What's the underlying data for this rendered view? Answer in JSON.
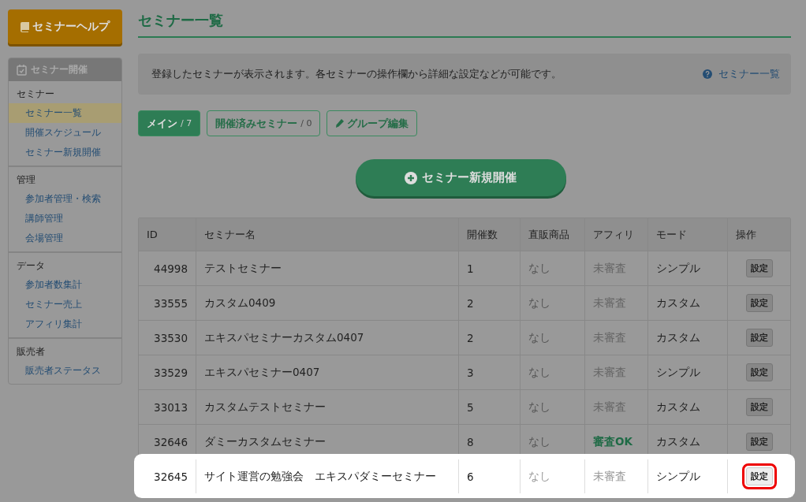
{
  "sidebar": {
    "help_button": "セミナーヘルプ",
    "panel_title": "セミナー開催",
    "sections": [
      {
        "heading": "セミナー",
        "items": [
          {
            "label": "セミナー一覧",
            "selected": true
          },
          {
            "label": "開催スケジュール",
            "selected": false
          },
          {
            "label": "セミナー新規開催",
            "selected": false
          }
        ]
      },
      {
        "heading": "管理",
        "items": [
          {
            "label": "参加者管理・検索",
            "selected": false
          },
          {
            "label": "講師管理",
            "selected": false
          },
          {
            "label": "会場管理",
            "selected": false
          }
        ]
      },
      {
        "heading": "データ",
        "items": [
          {
            "label": "参加者数集計",
            "selected": false
          },
          {
            "label": "セミナー売上",
            "selected": false
          },
          {
            "label": "アフィリ集計",
            "selected": false
          }
        ]
      },
      {
        "heading": "販売者",
        "items": [
          {
            "label": "販売者ステータス",
            "selected": false
          }
        ]
      }
    ]
  },
  "page_title": "セミナー一覧",
  "info": {
    "text": "登録したセミナーが表示されます。各セミナーの操作欄から詳細な設定などが可能です。",
    "help_link": "セミナー一覧"
  },
  "tabs": [
    {
      "label": "メイン",
      "count": "/ 7",
      "selected": true
    },
    {
      "label": "開催済みセミナー",
      "count": "/ 0",
      "selected": false
    }
  ],
  "group_edit_button": "グループ編集",
  "new_button": "セミナー新規開催",
  "table": {
    "columns": [
      "ID",
      "セミナー名",
      "開催数",
      "直販商品",
      "アフィリ",
      "モード",
      "操作"
    ],
    "rows": [
      {
        "id": "44998",
        "name": "テストセミナー",
        "count": "1",
        "product": "なし",
        "affiliate": "未審査",
        "approved": false,
        "mode": "シンプル",
        "action": "設定",
        "highlighted": false
      },
      {
        "id": "33555",
        "name": "カスタム0409",
        "count": "2",
        "product": "なし",
        "affiliate": "未審査",
        "approved": false,
        "mode": "カスタム",
        "action": "設定",
        "highlighted": false
      },
      {
        "id": "33530",
        "name": "エキスパセミナーカスタム0407",
        "count": "2",
        "product": "なし",
        "affiliate": "未審査",
        "approved": false,
        "mode": "カスタム",
        "action": "設定",
        "highlighted": false
      },
      {
        "id": "33529",
        "name": "エキスパセミナー0407",
        "count": "3",
        "product": "なし",
        "affiliate": "未審査",
        "approved": false,
        "mode": "シンプル",
        "action": "設定",
        "highlighted": false
      },
      {
        "id": "33013",
        "name": "カスタムテストセミナー",
        "count": "5",
        "product": "なし",
        "affiliate": "未審査",
        "approved": false,
        "mode": "カスタム",
        "action": "設定",
        "highlighted": false
      },
      {
        "id": "32646",
        "name": "ダミーカスタムセミナー",
        "count": "8",
        "product": "なし",
        "affiliate": "審査OK",
        "approved": true,
        "mode": "カスタム",
        "action": "設定",
        "highlighted": false
      },
      {
        "id": "32645",
        "name": "サイト運営の勉強会　エキスパダミーセミナー",
        "count": "6",
        "product": "なし",
        "affiliate": "未審査",
        "approved": false,
        "mode": "シンプル",
        "action": "設定",
        "highlighted": true
      }
    ]
  }
}
